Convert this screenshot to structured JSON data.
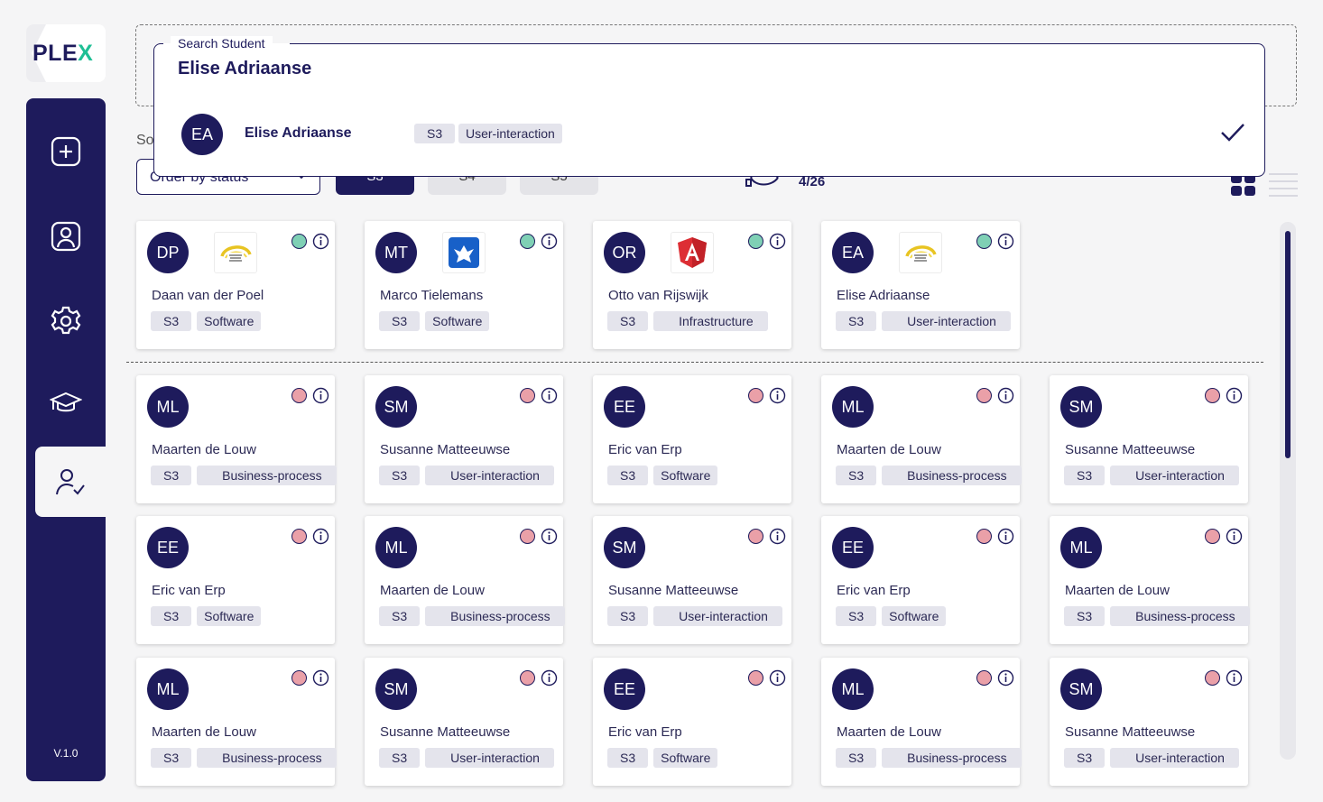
{
  "app": {
    "logo_main": "PLE",
    "logo_accent": "X",
    "version": "V.1.0"
  },
  "nav": [
    {
      "icon": "add-square-icon"
    },
    {
      "icon": "user-profile-icon"
    },
    {
      "icon": "settings-gear-icon"
    },
    {
      "icon": "graduation-cap-icon"
    },
    {
      "icon": "user-check-icon",
      "active": true
    }
  ],
  "search": {
    "label": "Search Student",
    "value": "Elise Adriaanse",
    "result": {
      "initials": "EA",
      "name": "Elise Adriaanse",
      "semester": "S3",
      "track": "User-interaction",
      "selected": true
    }
  },
  "toolbar": {
    "sort_label": "So",
    "order_select": "Order by status",
    "semesters": [
      {
        "label": "S3",
        "active": true
      },
      {
        "label": "S4",
        "active": false
      },
      {
        "label": "S5",
        "active": false
      }
    ],
    "count": "4/26"
  },
  "assigned": [
    {
      "initials": "DP",
      "name": "Daan van der Poel",
      "semester": "S3",
      "track": "Software",
      "status": "green",
      "company": "solar-team-logo"
    },
    {
      "initials": "MT",
      "name": "Marco Tielemans",
      "semester": "S3",
      "track": "Software",
      "status": "green",
      "company": "eagle-logo"
    },
    {
      "initials": "OR",
      "name": "Otto van Rijswijk",
      "semester": "S3",
      "track": "Infrastructure",
      "status": "green",
      "company": "angular-logo"
    },
    {
      "initials": "EA",
      "name": "Elise Adriaanse",
      "semester": "S3",
      "track": "User-interaction",
      "status": "green",
      "company": "solar-team-logo"
    }
  ],
  "students": [
    {
      "initials": "ML",
      "name": "Maarten de Louw",
      "semester": "S3",
      "track": "Business-process",
      "status": "red"
    },
    {
      "initials": "SM",
      "name": "Susanne Matteeuwse",
      "semester": "S3",
      "track": "User-interaction",
      "status": "red"
    },
    {
      "initials": "EE",
      "name": "Eric van Erp",
      "semester": "S3",
      "track": "Software",
      "status": "red"
    },
    {
      "initials": "ML",
      "name": "Maarten de Louw",
      "semester": "S3",
      "track": "Business-process",
      "status": "red"
    },
    {
      "initials": "SM",
      "name": "Susanne Matteeuwse",
      "semester": "S3",
      "track": "User-interaction",
      "status": "red"
    },
    {
      "initials": "EE",
      "name": "Eric van Erp",
      "semester": "S3",
      "track": "Software",
      "status": "red"
    },
    {
      "initials": "ML",
      "name": "Maarten de Louw",
      "semester": "S3",
      "track": "Business-process",
      "status": "red"
    },
    {
      "initials": "SM",
      "name": "Susanne Matteeuwse",
      "semester": "S3",
      "track": "User-interaction",
      "status": "red"
    },
    {
      "initials": "EE",
      "name": "Eric van Erp",
      "semester": "S3",
      "track": "Software",
      "status": "red"
    },
    {
      "initials": "ML",
      "name": "Maarten de Louw",
      "semester": "S3",
      "track": "Business-process",
      "status": "red"
    },
    {
      "initials": "ML",
      "name": "Maarten de Louw",
      "semester": "S3",
      "track": "Business-process",
      "status": "red"
    },
    {
      "initials": "SM",
      "name": "Susanne Matteeuwse",
      "semester": "S3",
      "track": "User-interaction",
      "status": "red"
    },
    {
      "initials": "EE",
      "name": "Eric van Erp",
      "semester": "S3",
      "track": "Software",
      "status": "red"
    },
    {
      "initials": "ML",
      "name": "Maarten de Louw",
      "semester": "S3",
      "track": "Business-process",
      "status": "red"
    },
    {
      "initials": "SM",
      "name": "Susanne Matteeuwse",
      "semester": "S3",
      "track": "User-interaction",
      "status": "red"
    }
  ],
  "colors": {
    "primary": "#1e1b5c",
    "accent": "#1fbf95",
    "status_green": "#7fd0b5",
    "status_red": "#eaa0a8"
  }
}
